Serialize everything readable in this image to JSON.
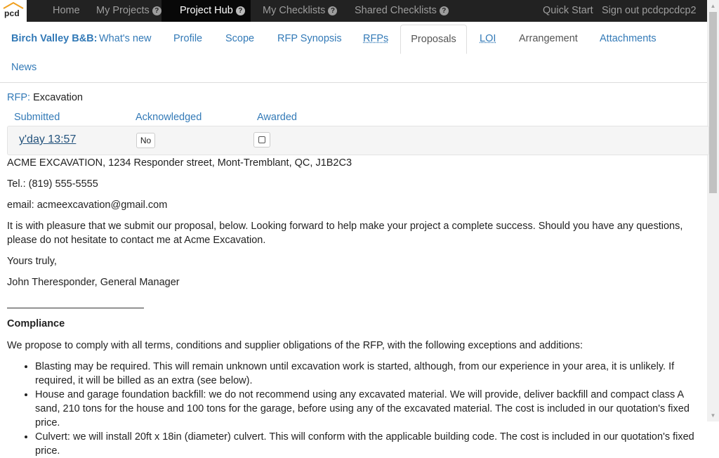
{
  "topnav": {
    "logo_text": "pcd",
    "items": [
      {
        "label": "Home",
        "help": false
      },
      {
        "label": "My Projects",
        "help": true
      },
      {
        "label": "Project Hub",
        "help": true,
        "active": true
      },
      {
        "label": "My Checklists",
        "help": true
      },
      {
        "label": "Shared Checklists",
        "help": true
      }
    ],
    "help_glyph": "?",
    "quick_start": "Quick Start",
    "sign_out": "Sign out pcdcpcdcp2"
  },
  "tabs": {
    "project_name": "Birch Valley B&B:",
    "items": [
      "What's new",
      "Profile",
      "Scope",
      "RFP Synopsis",
      "RFPs",
      "Proposals",
      "LOI",
      "Arrangement",
      "Attachments",
      "News"
    ],
    "active": "Proposals"
  },
  "rfp": {
    "label": "RFP:",
    "name": "Excavation"
  },
  "table": {
    "headers": [
      "Submitted",
      "Acknowledged",
      "Awarded"
    ],
    "row": {
      "submitted": "y'day 13:57",
      "acknowledged": "No"
    }
  },
  "proposal": {
    "address": "ACME EXCAVATION, 1234 Responder street, Mont-Tremblant, QC, J1B2C3",
    "tel": "Tel.: (819) 555-5555",
    "email": "email: acmeexcavation@gmail.com",
    "intro": "It is with pleasure that we submit our proposal, below. Looking forward to help make your project a complete success. Should you have any questions, please do not hesitate to contact me at Acme Excavation.",
    "closing": "Yours truly,",
    "signature": "John Theresponder, General Manager",
    "compliance_heading": "Compliance",
    "compliance_text": "We propose to comply with all terms, conditions and supplier obligations of the RFP, with the following exceptions and additions:",
    "bullets": [
      "Blasting may be required. This will remain unknown until excavation work is started, although, from our experience in your area, it is unlikely. If required, it will be billed as an extra (see below).",
      "House and garage foundation backfill: we do not recommend using any excavated material. We will provide, deliver backfill and compact class A sand, 210 tons for the house and 100 tons for the garage, before using any of the excavated material. The cost is included in our quotation's fixed price.",
      "Culvert: we will install 20ft x 18in (diameter) culvert. This will conform with the applicable building code. The cost is included in our quotation's fixed price."
    ]
  }
}
